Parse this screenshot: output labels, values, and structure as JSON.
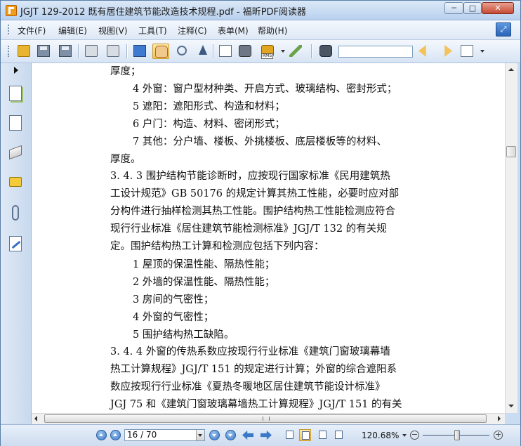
{
  "window": {
    "title": "JGJT 129-2012 既有居住建筑节能改造技术规程.pdf - 福昕PDF阅读器",
    "minimize": "─",
    "maximize": "□",
    "close": "✕"
  },
  "menu": [
    {
      "label": "文件(F)"
    },
    {
      "label": "编辑(E)"
    },
    {
      "label": "视图(V)"
    },
    {
      "label": "工具(T)"
    },
    {
      "label": "注释(C)"
    },
    {
      "label": "表单(M)"
    },
    {
      "label": "帮助(H)"
    }
  ],
  "toolbar": {
    "icons": [
      "open-folder-icon",
      "save-icon",
      "save-as-icon",
      "print-icon",
      "scan-icon",
      "fullscreen-icon",
      "hand-icon",
      "zoom-icon",
      "select-arrow-icon",
      "text-select-icon",
      "snapshot-icon",
      "rms-lock-icon",
      "sign-icon",
      "search-binoculars-icon",
      "previous-result-icon",
      "next-result-icon",
      "bookmark-icon"
    ],
    "rms_label": "RMS",
    "search_value": ""
  },
  "document": {
    "lines": [
      {
        "text": "厚度；"
      },
      {
        "text": "4   外窗：窗户型材种类、开启方式、玻璃结构、密封形式；"
      },
      {
        "text": "5   遮阳：遮阳形式、构造和材料；"
      },
      {
        "text": "6   户门：构造、材料、密闭形式；"
      },
      {
        "text": "7   其他：分户墙、楼板、外挑楼板、底层楼板等的材料、"
      },
      {
        "text": "厚度。"
      },
      {
        "text": "3. 4. 3   围护结构节能诊断时，应按现行国家标准《民用建筑热"
      },
      {
        "text": "工设计规范》GB 50176 的规定计算其热工性能，必要时应对部"
      },
      {
        "text": "分构件进行抽样检测其热工性能。围护结构热工性能检测应符合"
      },
      {
        "text": "现行行业标准《居住建筑节能检测标准》JGJ/T 132 的有关规"
      },
      {
        "text": "定。围护结构热工计算和检测应包括下列内容："
      },
      {
        "text": "1   屋顶的保温性能、隔热性能；"
      },
      {
        "text": "2   外墙的保温性能、隔热性能；"
      },
      {
        "text": "3   房间的气密性；"
      },
      {
        "text": "4   外窗的气密性；"
      },
      {
        "text": "5   围护结构热工缺陷。"
      },
      {
        "text": "3. 4. 4   外窗的传热系数应按现行行业标准《建筑门窗玻璃幕墙"
      },
      {
        "text": "热工计算规程》JGJ/T 151 的规定进行计算；外窗的综合遮阳系"
      },
      {
        "text": "数应按现行行业标准《夏热冬暖地区居住建筑节能设计标准》"
      },
      {
        "text": "JGJ 75 和《建筑门窗玻璃幕墙热工计算规程》JGJ/T 151 的有关"
      }
    ]
  },
  "status": {
    "page_display": "16 / 70",
    "zoom": "120.68%",
    "zoom_minus": "−",
    "zoom_plus": "+"
  }
}
